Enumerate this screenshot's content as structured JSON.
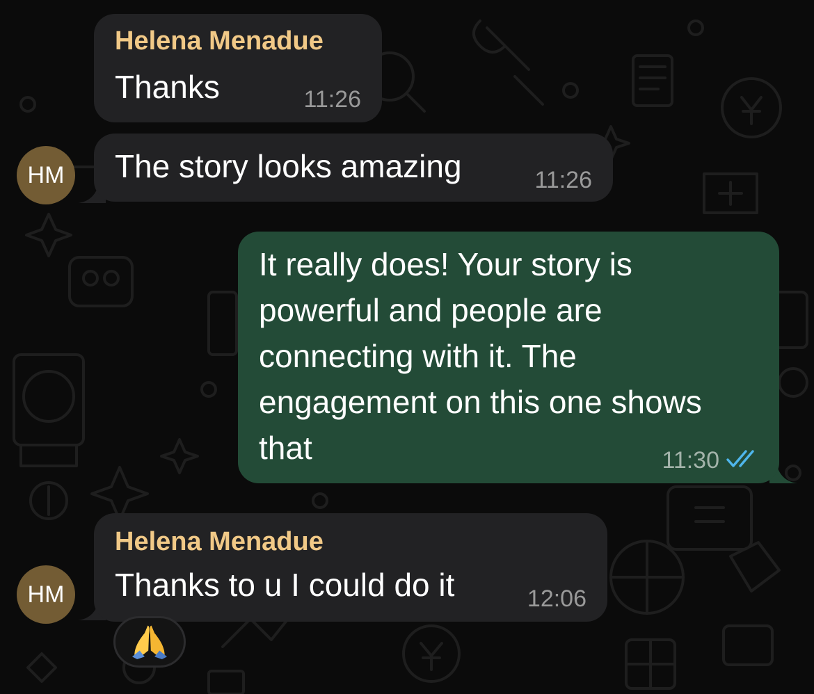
{
  "chat": {
    "contact_initials": "HM",
    "messages": [
      {
        "direction": "incoming",
        "sender": "Helena Menadue",
        "text": "Thanks",
        "time": "11:26"
      },
      {
        "direction": "incoming",
        "text": "The story looks amazing",
        "time": "11:26"
      },
      {
        "direction": "outgoing",
        "text": "It really does! Your story is powerful and people are connecting with it. The engagement on this one shows that",
        "time": "11:30",
        "status": "read"
      },
      {
        "direction": "incoming",
        "sender": "Helena Menadue",
        "text": "Thanks to u I could do it",
        "time": "12:06",
        "reaction": "praying-hands"
      }
    ]
  },
  "colors": {
    "background": "#0b0b0b",
    "incoming_bubble": "#222224",
    "outgoing_bubble": "#234b37",
    "sender_name": "#f1c987",
    "read_ticks": "#4fb6ec",
    "avatar": "#735c34"
  }
}
